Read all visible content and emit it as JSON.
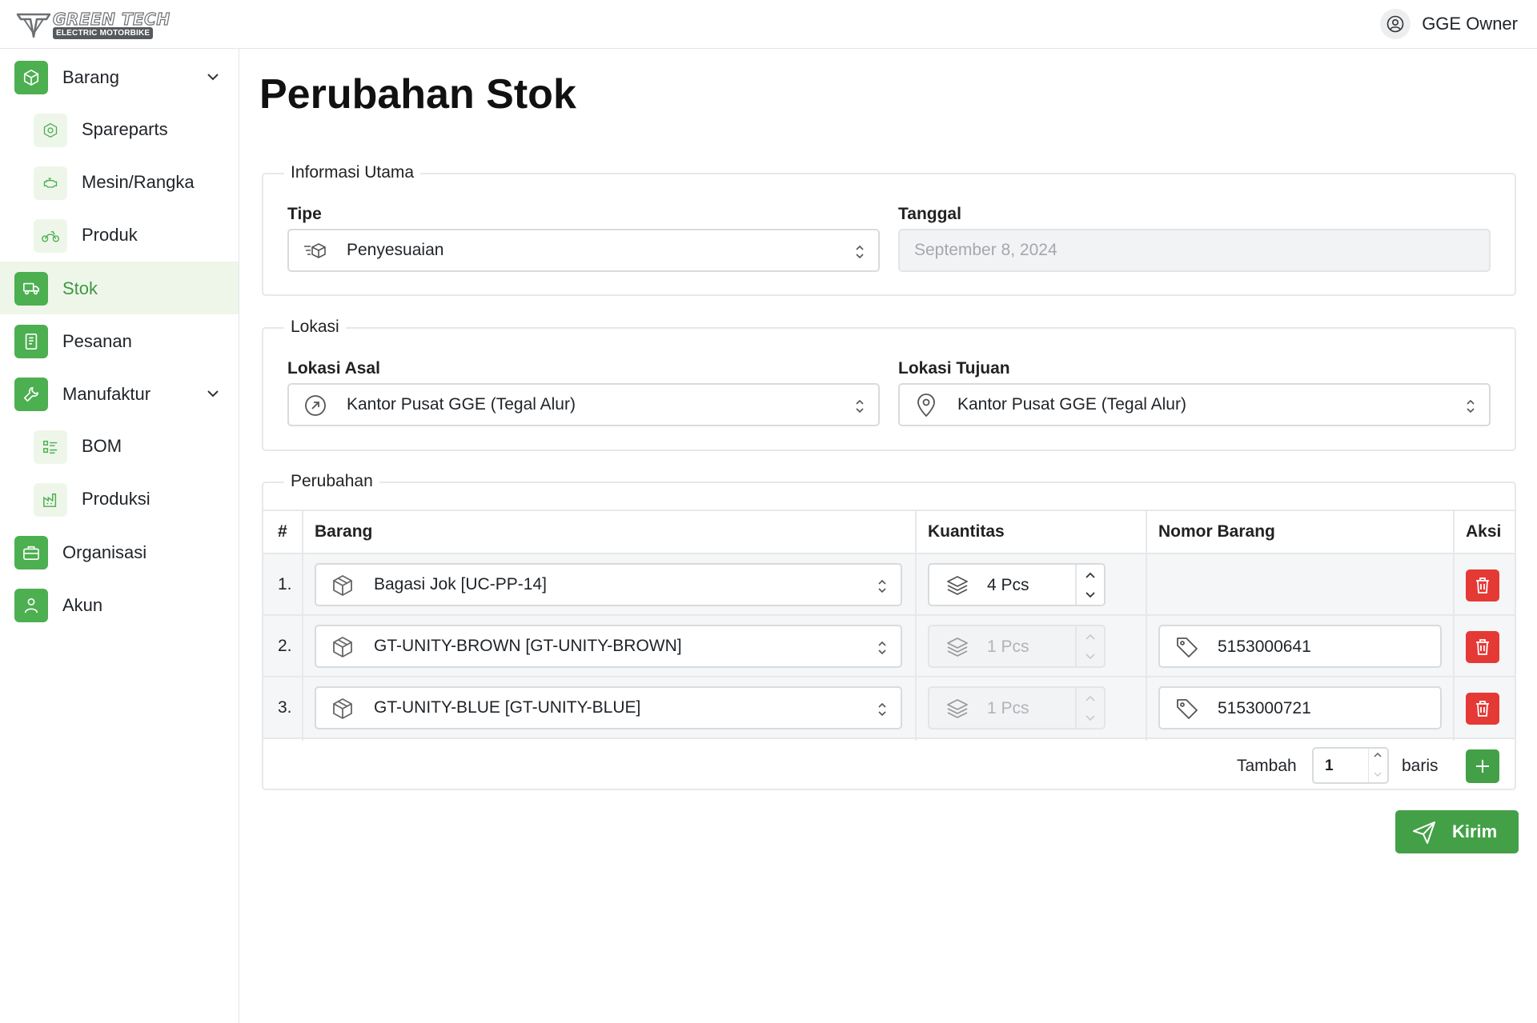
{
  "header": {
    "brand_title": "GREEN TECH",
    "brand_subtitle": "ELECTRIC MOTORBIKE",
    "user_name": "GGE Owner"
  },
  "sidebar": {
    "items": [
      {
        "label": "Barang",
        "icon": "box-icon",
        "expanded": true
      },
      {
        "label": "Spareparts",
        "icon": "hexagon-nut-icon",
        "sub": true
      },
      {
        "label": "Mesin/Rangka",
        "icon": "engine-icon",
        "sub": true
      },
      {
        "label": "Produk",
        "icon": "motorbike-icon",
        "sub": true
      },
      {
        "label": "Stok",
        "icon": "truck-icon",
        "active": true
      },
      {
        "label": "Pesanan",
        "icon": "receipt-icon"
      },
      {
        "label": "Manufaktur",
        "icon": "wrench-icon",
        "expanded": true
      },
      {
        "label": "BOM",
        "icon": "list-icon",
        "sub": true
      },
      {
        "label": "Produksi",
        "icon": "factory-icon",
        "sub": true
      },
      {
        "label": "Organisasi",
        "icon": "briefcase-icon"
      },
      {
        "label": "Akun",
        "icon": "user-icon"
      }
    ]
  },
  "page": {
    "title": "Perubahan Stok"
  },
  "info": {
    "legend": "Informasi Utama",
    "tipe_label": "Tipe",
    "tipe_value": "Penyesuaian",
    "tanggal_label": "Tanggal",
    "tanggal_placeholder": "September 8, 2024"
  },
  "lokasi": {
    "legend": "Lokasi",
    "asal_label": "Lokasi Asal",
    "asal_value": "Kantor Pusat GGE (Tegal Alur)",
    "tujuan_label": "Lokasi Tujuan",
    "tujuan_value": "Kantor Pusat GGE (Tegal Alur)"
  },
  "perubahan": {
    "legend": "Perubahan",
    "columns": [
      "#",
      "Barang",
      "Kuantitas",
      "Nomor Barang",
      "Aksi"
    ],
    "rows": [
      {
        "num": "1.",
        "barang": "Bagasi Jok [UC-PP-14]",
        "kuantitas": "4 Pcs",
        "qty_disabled": false,
        "nomor": ""
      },
      {
        "num": "2.",
        "barang": "GT-UNITY-BROWN [GT-UNITY-BROWN]",
        "kuantitas": "1 Pcs",
        "qty_disabled": true,
        "nomor": "5153000641"
      },
      {
        "num": "3.",
        "barang": "GT-UNITY-BLUE [GT-UNITY-BLUE]",
        "kuantitas": "1 Pcs",
        "qty_disabled": true,
        "nomor": "5153000721"
      }
    ],
    "tambah_label": "Tambah",
    "tambah_value": "1",
    "baris_label": "baris"
  },
  "submit_label": "Kirim",
  "colors": {
    "accent": "#43a047",
    "active_bg": "#eef6ea",
    "danger": "#e53935"
  }
}
